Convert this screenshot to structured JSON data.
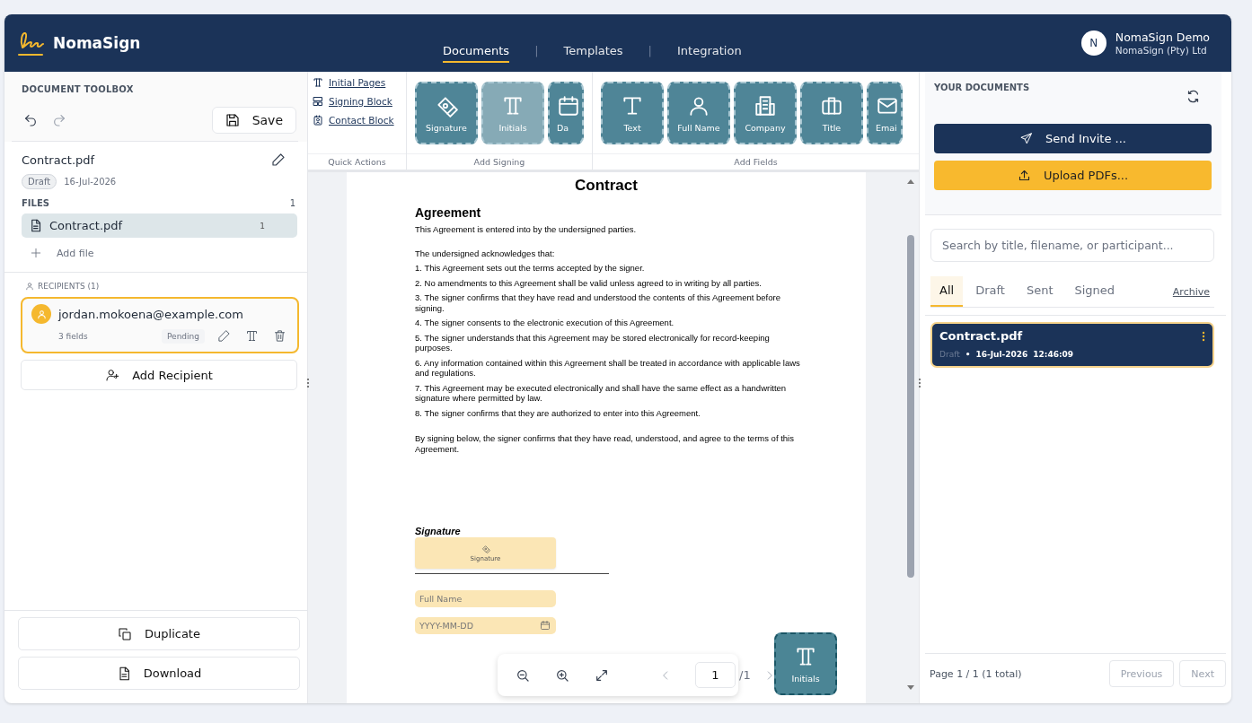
{
  "app": {
    "name": "NomaSign"
  },
  "nav_separator": "|",
  "nav": [
    {
      "label": "Documents",
      "selected": true
    },
    {
      "label": "Templates",
      "selected": false
    },
    {
      "label": "Integration",
      "selected": false
    }
  ],
  "user": {
    "initial": "N",
    "name": "NomaSign Demo",
    "org": "NomaSign (Pty) Ltd"
  },
  "toolbox": {
    "title": "DOCUMENT TOOLBOX",
    "save": "Save",
    "document": {
      "name": "Contract.pdf",
      "status": "Draft",
      "date": "16-Jul-2026"
    },
    "files_label": "FILES",
    "files_count": "1",
    "files": [
      {
        "name": "Contract.pdf",
        "pages": "1",
        "selected": true
      }
    ],
    "add_file": "Add file",
    "recipients_label": "RECIPIENTS (1)",
    "recipients": [
      {
        "email": "jordan.mokoena@example.com",
        "fields": "3 fields",
        "status": "Pending",
        "selected": true
      }
    ],
    "add_recipient": "Add Recipient",
    "duplicate": "Duplicate",
    "download": "Download"
  },
  "quick_actions": {
    "label": "Quick Actions",
    "items": [
      {
        "kind": "initials",
        "label": "Initial Pages"
      },
      {
        "kind": "block",
        "label": "Signing Block"
      },
      {
        "kind": "contact",
        "label": "Contact Block"
      }
    ]
  },
  "add_signing": {
    "label": "Add Signing",
    "tiles": [
      {
        "kind": "signature",
        "label": "Signature",
        "selected": false
      },
      {
        "kind": "initials",
        "label": "Initials",
        "selected": true
      },
      {
        "kind": "date",
        "label": "Da",
        "selected": false,
        "cut": true
      }
    ]
  },
  "add_fields": {
    "label": "Add Fields",
    "tiles": [
      {
        "kind": "text",
        "label": "Text",
        "selected": false
      },
      {
        "kind": "person",
        "label": "Full Name",
        "selected": false
      },
      {
        "kind": "company",
        "label": "Company",
        "selected": false
      },
      {
        "kind": "title",
        "label": "Title",
        "selected": false
      },
      {
        "kind": "email",
        "label": "Emai",
        "selected": false,
        "cut": true
      }
    ]
  },
  "document": {
    "title": "Contract",
    "heading": "Agreement",
    "paragraphs": [
      {
        "kind": "intro",
        "text": "This Agreement is entered into by the undersigned parties."
      },
      {
        "kind": "text",
        "text": "The undersigned acknowledges that:"
      },
      {
        "kind": "item",
        "text": "1. This Agreement sets out the terms accepted by the signer."
      },
      {
        "kind": "item",
        "text": "2. No amendments to this Agreement shall be valid unless agreed to in writing by all parties."
      },
      {
        "kind": "item",
        "text": "3. The signer confirms that they have read and understood the contents of this Agreement before signing."
      },
      {
        "kind": "item",
        "text": "4. The signer consents to the electronic execution of this Agreement."
      },
      {
        "kind": "item",
        "text": "5. The signer understands that this Agreement may be stored electronically for record-keeping purposes."
      },
      {
        "kind": "item",
        "text": "6. Any information contained within this Agreement shall be treated in accordance with applicable laws and regulations."
      },
      {
        "kind": "item",
        "text": "7. This Agreement may be executed electronically and shall have the same effect as a handwritten signature where permitted by law."
      },
      {
        "kind": "item",
        "text": "8. The signer confirms that they are authorized to enter into this Agreement."
      },
      {
        "kind": "closing",
        "text": "By signing below, the signer confirms that they have read, understood, and agree to the terms of this Agreement."
      }
    ],
    "signature_label": "Signature",
    "fields": [
      {
        "kind": "signature",
        "label": "Signature"
      },
      {
        "kind": "text",
        "placeholder": "Full Name"
      },
      {
        "kind": "date",
        "placeholder": "YYYY-MM-DD"
      }
    ]
  },
  "viewer": {
    "page": "1",
    "total": "/1"
  },
  "dragged_tile": {
    "kind": "initials",
    "label": "Initials"
  },
  "documents_panel": {
    "title": "YOUR DOCUMENTS",
    "send": "Send Invite ...",
    "upload": "Upload PDFs...",
    "search": {
      "placeholder": "Search by title, filename, or participant..."
    },
    "tabs": [
      {
        "label": "All",
        "selected": true
      },
      {
        "label": "Draft",
        "selected": false
      },
      {
        "label": "Sent",
        "selected": false
      },
      {
        "label": "Signed",
        "selected": false
      }
    ],
    "archive": "Archive",
    "items": [
      {
        "name": "Contract.pdf",
        "status": "Draft",
        "separator": "•",
        "date": "16-Jul-2026",
        "time": "12:46:09",
        "selected": true
      }
    ],
    "pagination": "Page 1 / 1 (1 total)",
    "previous": {
      "label": "Previous",
      "disabled": true
    },
    "next": {
      "label": "Next",
      "disabled": true
    }
  }
}
